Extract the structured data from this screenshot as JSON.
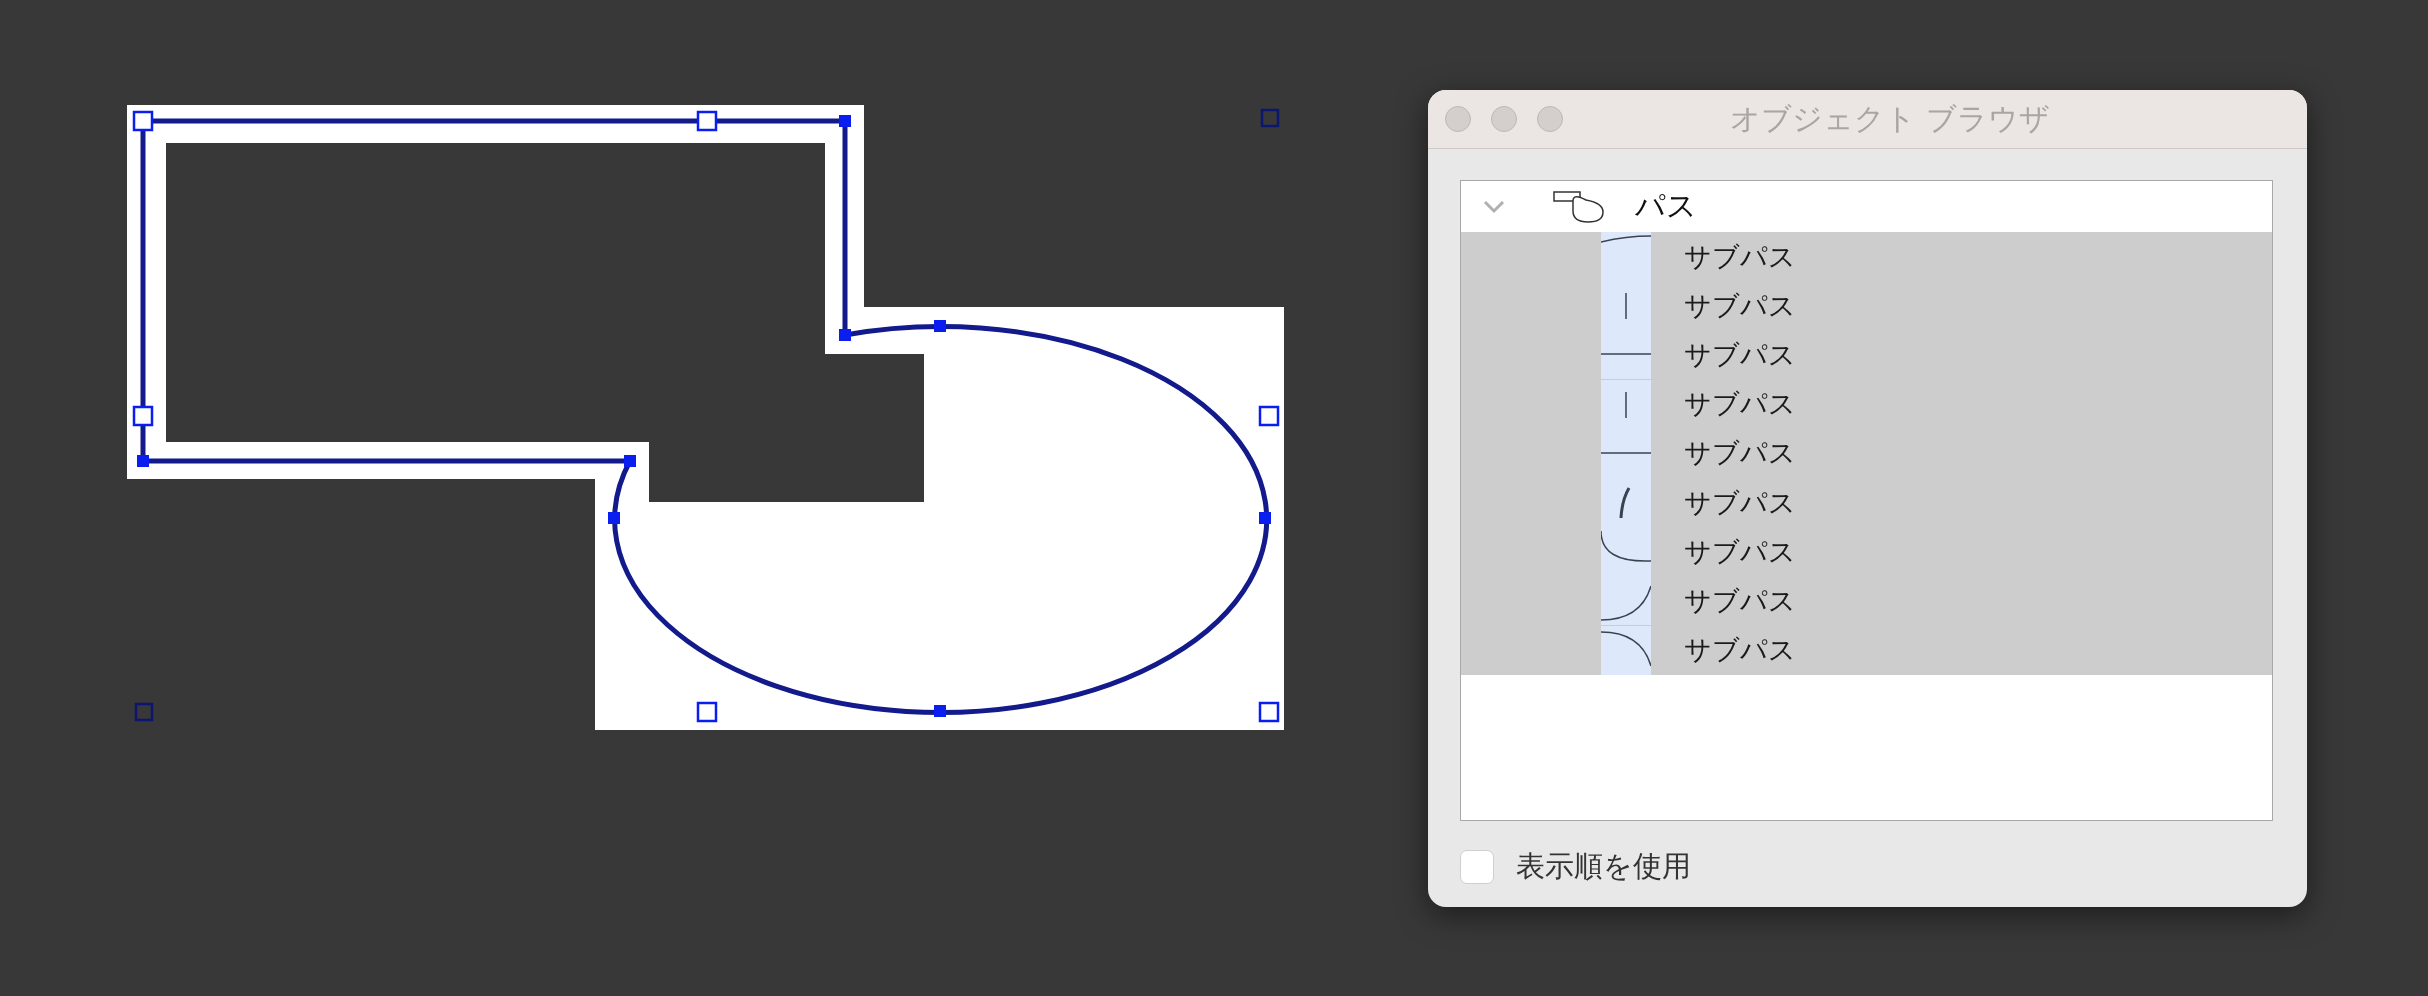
{
  "window": {
    "title": "オブジェクト ブラウザ"
  },
  "tree": [
    {
      "label": "パス",
      "expanded": true,
      "selected": false,
      "children": [
        {
          "label": "サブパス",
          "selected": true
        },
        {
          "label": "サブパス",
          "selected": true
        },
        {
          "label": "サブパス",
          "selected": true
        },
        {
          "label": "サブパス",
          "selected": true
        },
        {
          "label": "サブパス",
          "selected": true
        },
        {
          "label": "サブパス",
          "selected": true
        },
        {
          "label": "サブパス",
          "selected": true
        },
        {
          "label": "サブパス",
          "selected": true
        },
        {
          "label": "サブパス",
          "selected": true
        }
      ]
    }
  ],
  "checkbox": {
    "label": "表示順を使用",
    "checked": false
  }
}
